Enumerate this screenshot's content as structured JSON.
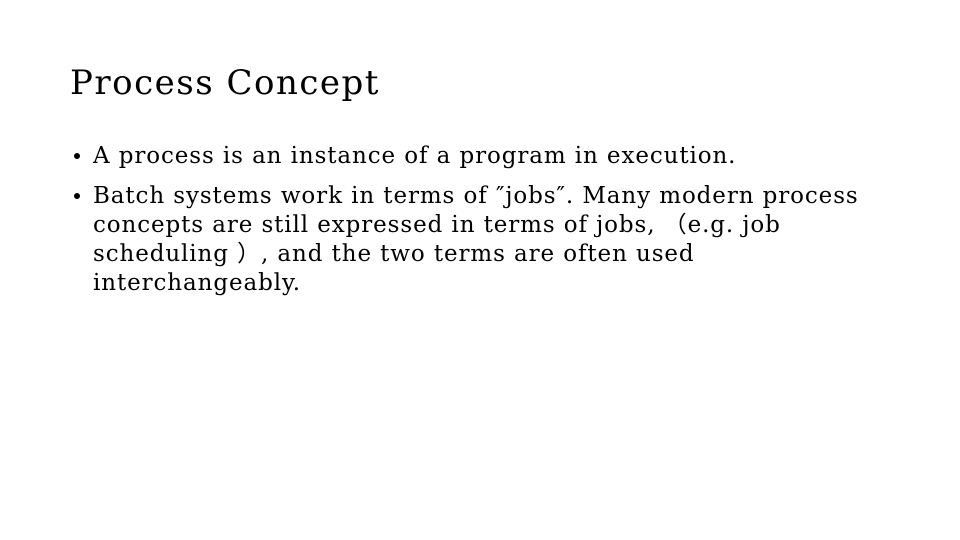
{
  "slide": {
    "title": "Process Concept",
    "bullets": [
      {
        "text": "A process is an instance of a program in execution."
      },
      {
        "text": "Batch systems work in terms of ″jobs″. Many modern process concepts are still expressed in terms of jobs, （e.g. job scheduling ）, and the two terms are often used interchangeably."
      }
    ],
    "bullet_glyph": "round-dot",
    "colors": {
      "background": "#ffffff",
      "text": "#000000"
    }
  }
}
